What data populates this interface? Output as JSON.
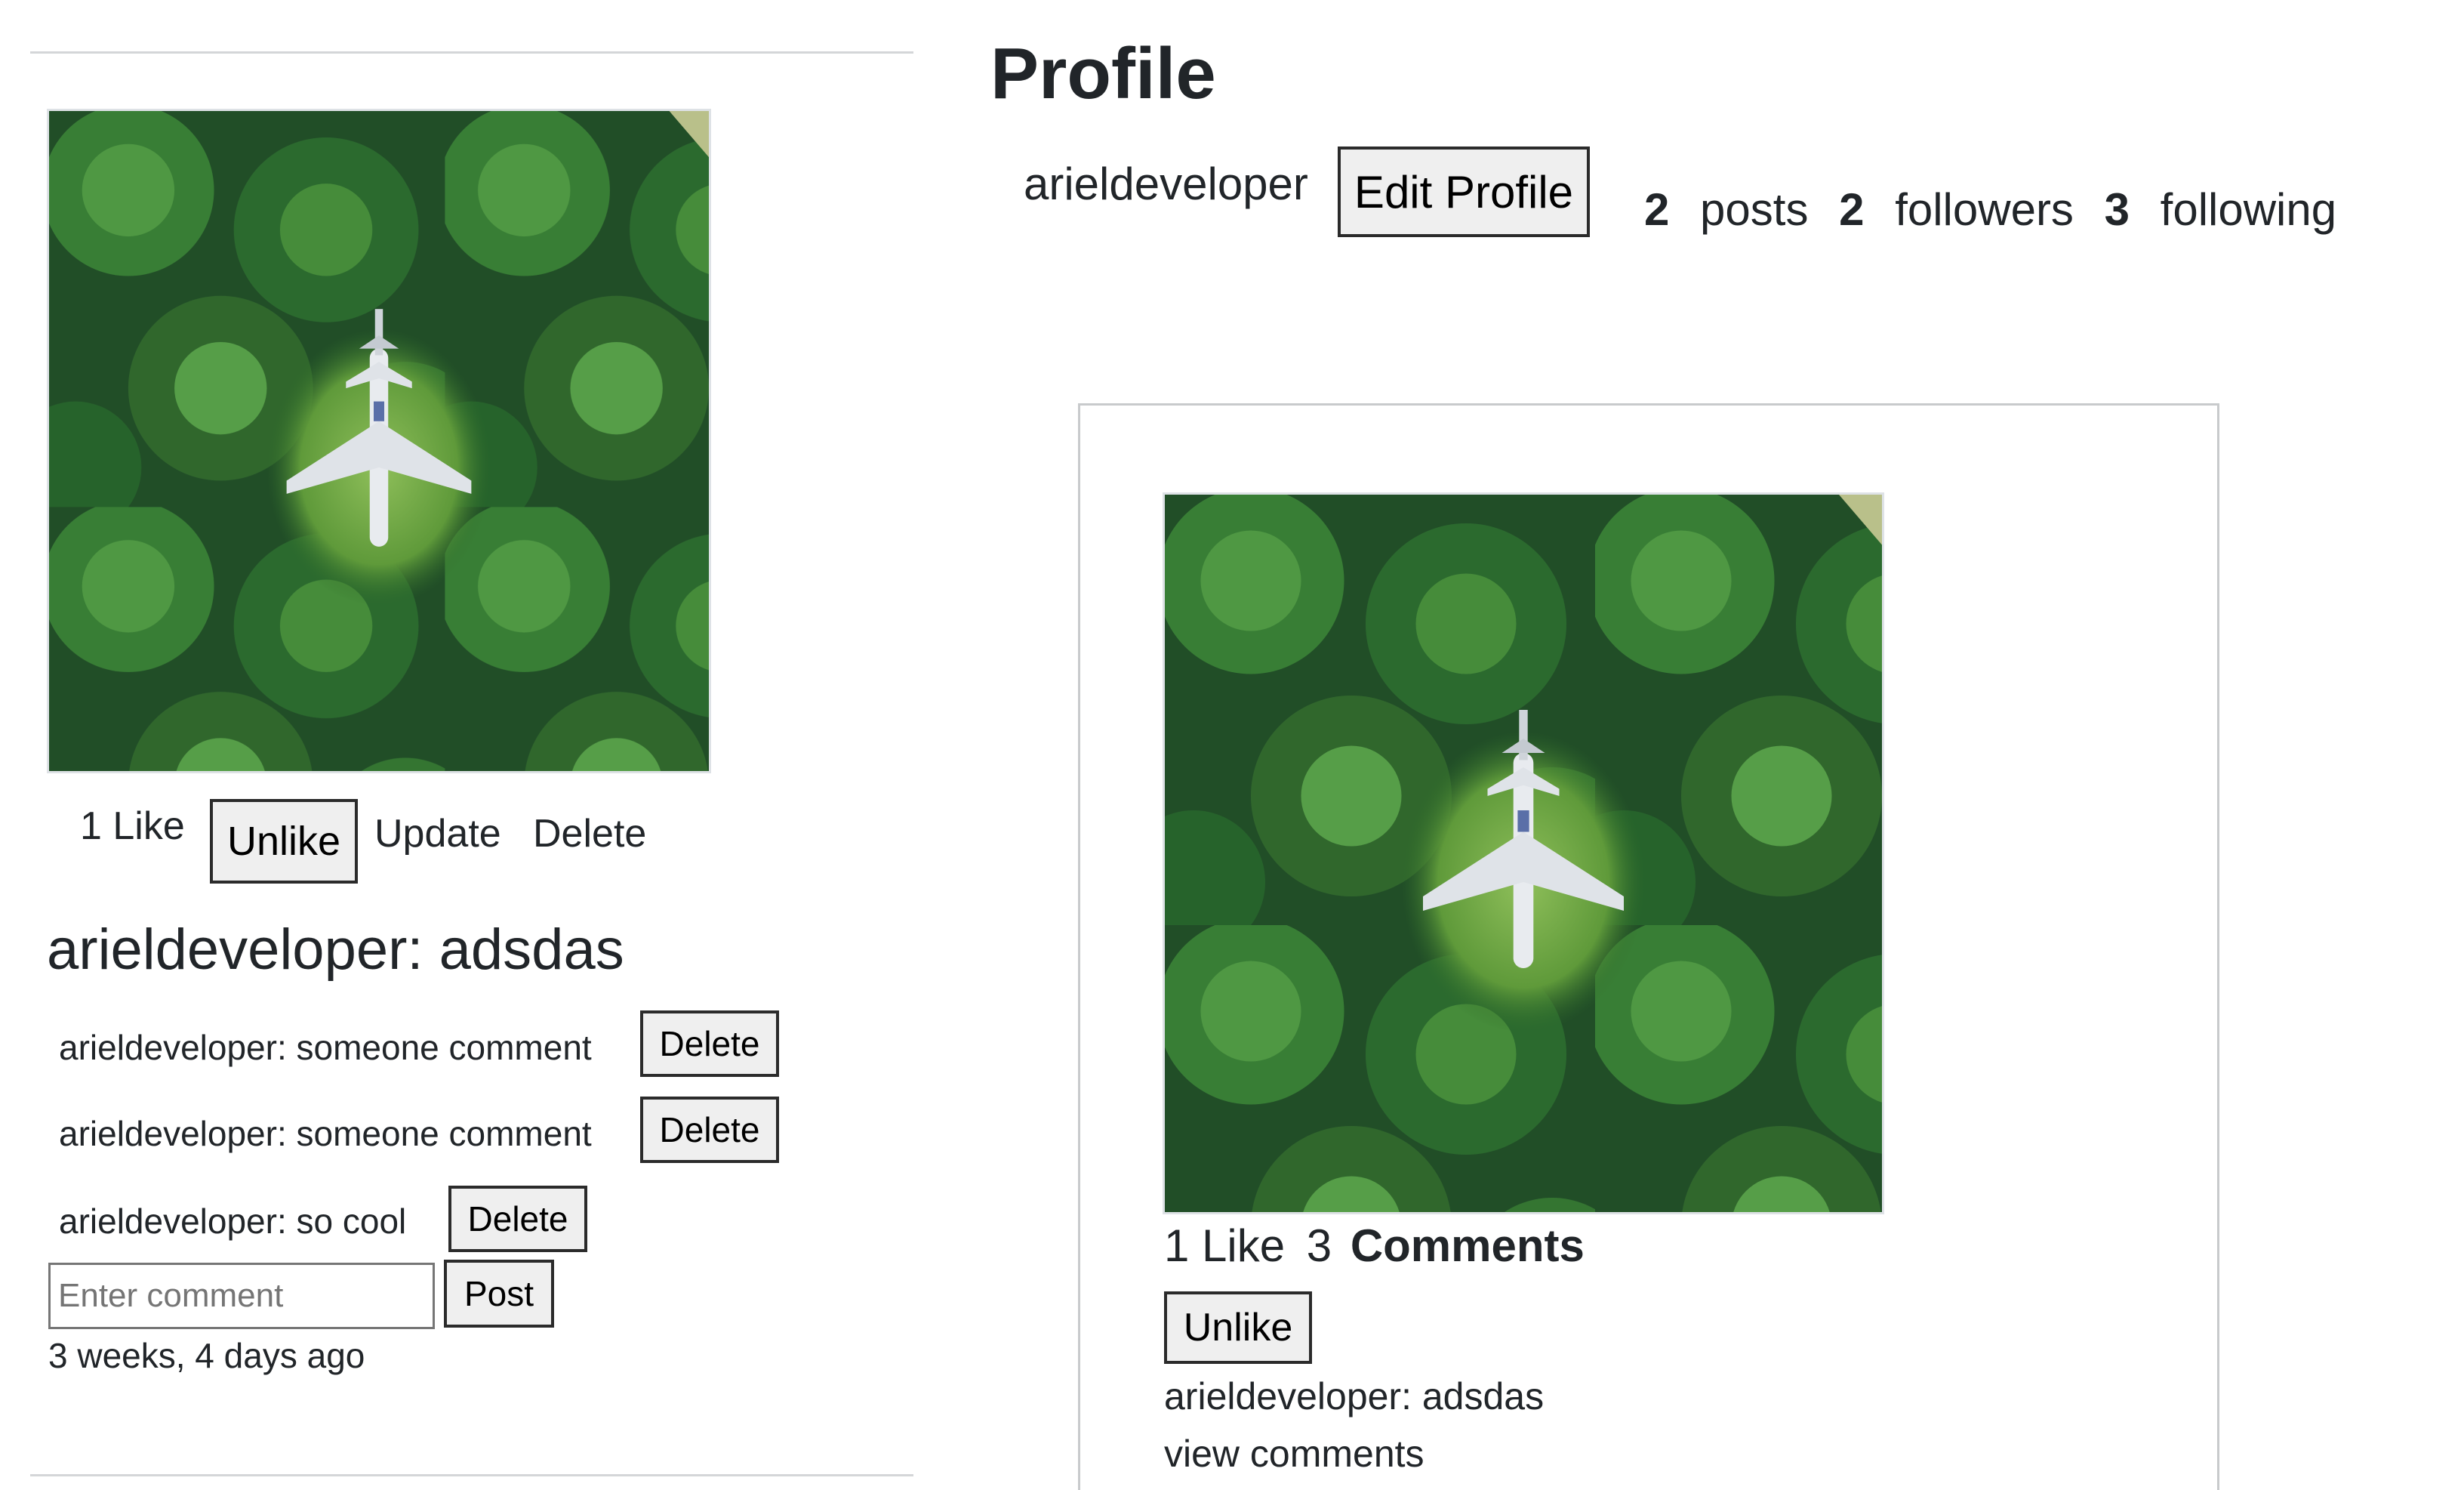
{
  "profile": {
    "title": "Profile",
    "username": "arieldeveloper",
    "edit_label": "Edit Profile",
    "stats": {
      "posts_count": "2",
      "posts_label": "posts",
      "followers_count": "2",
      "followers_label": "followers",
      "following_count": "3",
      "following_label": "following"
    }
  },
  "post_detail": {
    "likes_text": "1 Like",
    "unlike_label": "Unlike",
    "update_label": "Update",
    "delete_label": "Delete",
    "caption": "arieldeveloper: adsdas",
    "comments": [
      {
        "text": "arieldeveloper: someone comment",
        "delete_label": "Delete"
      },
      {
        "text": "arieldeveloper: someone comment",
        "delete_label": "Delete"
      },
      {
        "text": "arieldeveloper: so cool",
        "delete_label": "Delete"
      }
    ],
    "comment_input": {
      "placeholder": "Enter comment",
      "value": ""
    },
    "post_label": "Post",
    "timestamp": "3 weeks, 4 days ago",
    "image": {
      "icon": "airplane-in-forest-photo"
    }
  },
  "post_card": {
    "likes_text": "1 Like",
    "comments_count_text": "3",
    "comments_label": "Comments",
    "unlike_label": "Unlike",
    "caption": "arieldeveloper: adsdas",
    "view_comments": "view comments",
    "image": {
      "icon": "airplane-in-forest-photo"
    }
  },
  "colors": {
    "text": "#212529",
    "button_bg": "#efefef",
    "button_border": "#2b2b2b",
    "divider": "#d4d6d8",
    "forest_dark": "#1f4a24",
    "forest_light": "#4f9a3c"
  }
}
